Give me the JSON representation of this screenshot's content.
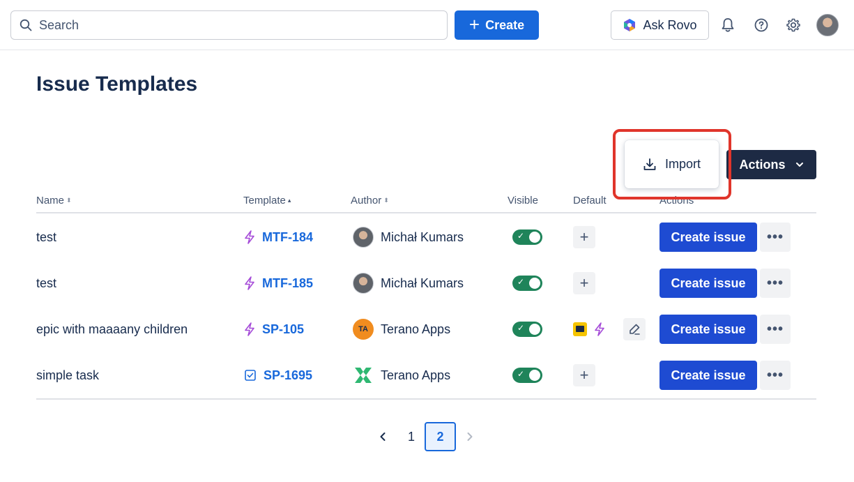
{
  "topbar": {
    "search_placeholder": "Search",
    "create_label": "Create",
    "rovo_label": "Ask Rovo"
  },
  "page": {
    "title": "Issue Templates"
  },
  "toolbar": {
    "import_label": "Import",
    "actions_label": "Actions"
  },
  "table": {
    "headers": {
      "name": "Name",
      "template": "Template",
      "author": "Author",
      "visible": "Visible",
      "default": "Default",
      "actions": "Actions"
    },
    "rows": [
      {
        "name": "test",
        "template": "MTF-184",
        "template_icon": "lightning-icon",
        "author": "Michał Kumars",
        "author_avatar": "photo",
        "visible": true,
        "create_label": "Create issue"
      },
      {
        "name": "test",
        "template": "MTF-185",
        "template_icon": "lightning-icon",
        "author": "Michał Kumars",
        "author_avatar": "photo",
        "visible": true,
        "create_label": "Create issue"
      },
      {
        "name": "epic with maaaany children",
        "template": "SP-105",
        "template_icon": "lightning-icon",
        "author": "Terano Apps",
        "author_avatar": "TA",
        "visible": true,
        "create_label": "Create issue"
      },
      {
        "name": "simple task",
        "template": "SP-1695",
        "template_icon": "checkbox-icon",
        "author": "Terano Apps",
        "author_avatar": "logo",
        "visible": true,
        "create_label": "Create issue"
      }
    ]
  },
  "pagination": {
    "pages": [
      "1",
      "2"
    ],
    "current": "2"
  },
  "colors": {
    "primary": "#1868db",
    "create_issue": "#1e4bd2",
    "toggle_on": "#1f845a",
    "highlight": "#e0352b",
    "lightning": "#a54bd8"
  }
}
